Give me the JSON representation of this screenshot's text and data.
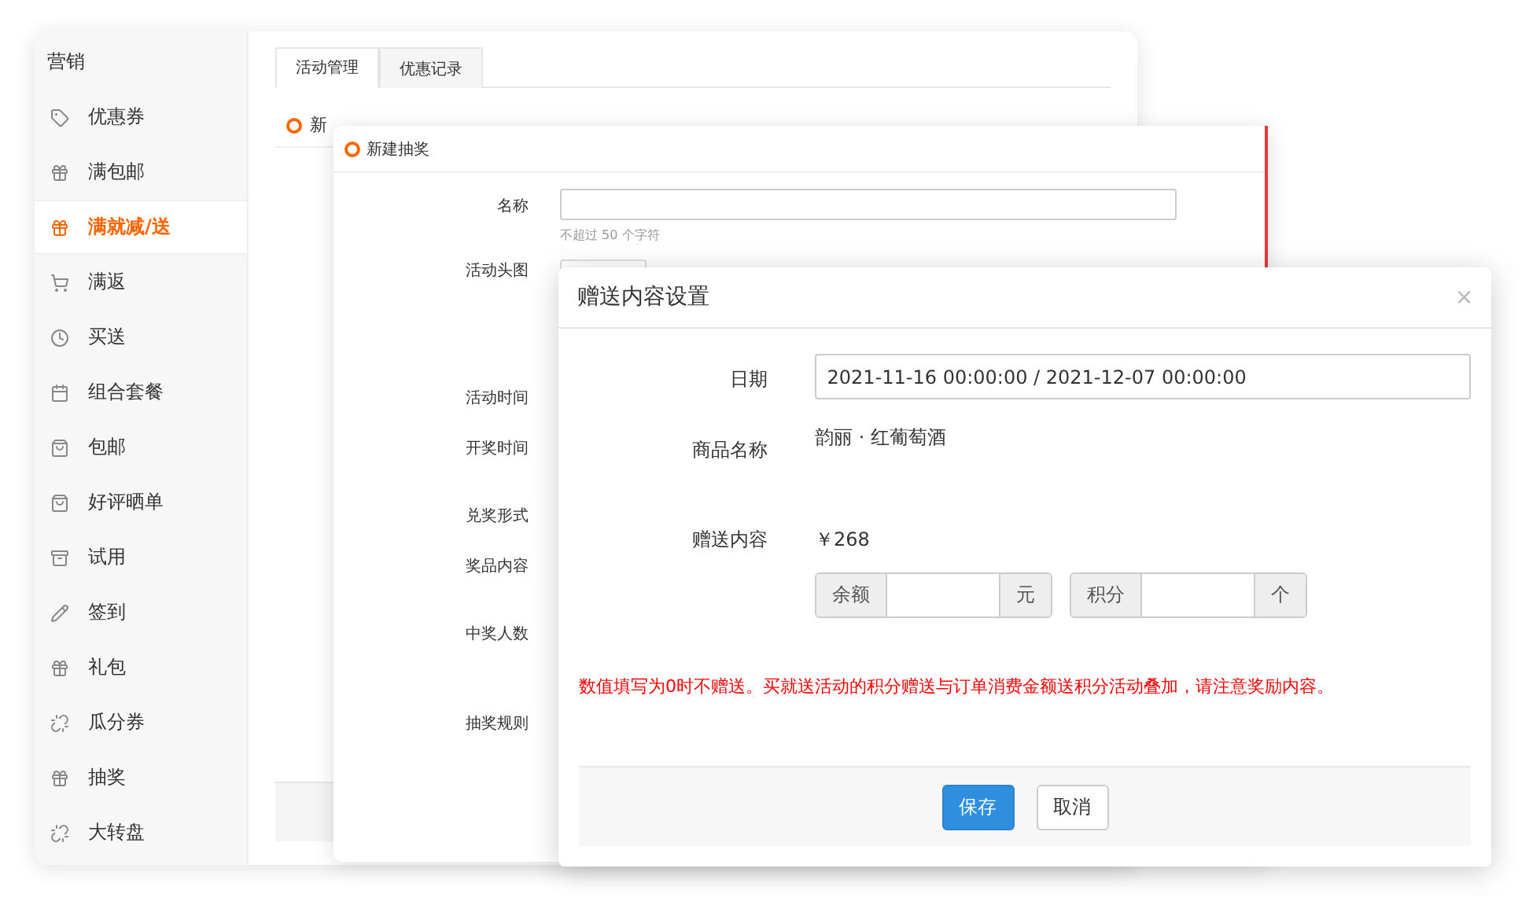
{
  "sidebar": {
    "title": "营销",
    "items": [
      {
        "label": "优惠券",
        "selected": false
      },
      {
        "label": "满包邮",
        "selected": false
      },
      {
        "label": "满就减/送",
        "selected": true
      },
      {
        "label": "满返",
        "selected": false
      },
      {
        "label": "买送",
        "selected": false
      },
      {
        "label": "组合套餐",
        "selected": false
      },
      {
        "label": "包邮",
        "selected": false
      },
      {
        "label": "好评晒单",
        "selected": false
      },
      {
        "label": "试用",
        "selected": false
      },
      {
        "label": "签到",
        "selected": false
      },
      {
        "label": "礼包",
        "selected": false
      },
      {
        "label": "瓜分券",
        "selected": false
      },
      {
        "label": "抽奖",
        "selected": false
      },
      {
        "label": "大转盘",
        "selected": false
      }
    ]
  },
  "tabs": [
    {
      "label": "活动管理",
      "selected": true
    },
    {
      "label": "优惠记录",
      "selected": false
    }
  ],
  "section_title": "新",
  "lottery_form": {
    "title": "新建抽奖",
    "fields": [
      {
        "label": "名称",
        "kind": "text",
        "hint": "不超过 50 个字符"
      },
      {
        "label": "活动头图",
        "kind": "upload"
      },
      {
        "label": "活动时间",
        "kind": "plain"
      },
      {
        "label": "开奖时间",
        "kind": "plain"
      },
      {
        "label": "兑奖形式",
        "kind": "plain"
      },
      {
        "label": "奖品内容",
        "kind": "plain"
      },
      {
        "label": "中奖人数",
        "kind": "plain"
      },
      {
        "label": "抽奖规则",
        "kind": "plain"
      }
    ]
  },
  "dialog": {
    "title": "赠送内容设置",
    "close": "×",
    "date": {
      "label": "日期",
      "value": "2021-11-16 00:00:00 / 2021-12-07 00:00:00"
    },
    "product": {
      "label": "商品名称",
      "value": "韵丽 · 红葡萄酒"
    },
    "gift": {
      "label": "赠送内容",
      "price": "￥268",
      "groups": [
        {
          "prefix": "余额",
          "suffix": "元"
        },
        {
          "prefix": "积分",
          "suffix": "个"
        }
      ]
    },
    "notice": "数值填写为0时不赠送。买就送活动的积分赠送与订单消费金额送积分活动叠加，请注意奖励内容。",
    "buttons": [
      {
        "label": "保存",
        "kind": "primary"
      },
      {
        "label": "取消",
        "kind": "default"
      }
    ]
  }
}
